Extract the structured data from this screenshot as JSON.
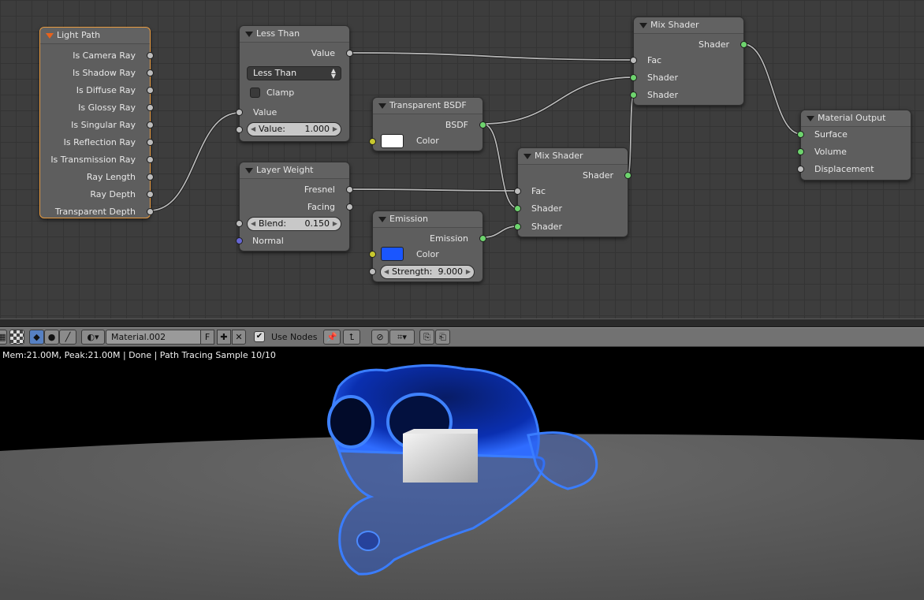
{
  "nodes": {
    "light_path": {
      "title": "Light Path",
      "outputs": [
        "Is Camera Ray",
        "Is Shadow Ray",
        "Is Diffuse Ray",
        "Is Glossy Ray",
        "Is Singular Ray",
        "Is Reflection Ray",
        "Is Transmission Ray",
        "Ray Length",
        "Ray Depth",
        "Transparent Depth"
      ]
    },
    "less_than": {
      "title": "Less Than",
      "output": "Value",
      "operation": "Less Than",
      "clamp_label": "Clamp",
      "input_label": "Value",
      "value_field_label": "Value:",
      "value_field_value": "1.000"
    },
    "layer_weight": {
      "title": "Layer Weight",
      "output_fresnel": "Fresnel",
      "output_facing": "Facing",
      "blend_label": "Blend:",
      "blend_value": "0.150",
      "normal_label": "Normal"
    },
    "transparent_bsdf": {
      "title": "Transparent BSDF",
      "output": "BSDF",
      "color_label": "Color",
      "color": "#ffffff"
    },
    "emission": {
      "title": "Emission",
      "output": "Emission",
      "color_label": "Color",
      "color": "#1a56ff",
      "strength_label": "Strength:",
      "strength_value": "9.000"
    },
    "mix_shader_top": {
      "title": "Mix Shader",
      "output": "Shader",
      "fac_label": "Fac",
      "shader1_label": "Shader",
      "shader2_label": "Shader"
    },
    "mix_shader_mid": {
      "title": "Mix Shader",
      "output": "Shader",
      "fac_label": "Fac",
      "shader1_label": "Shader",
      "shader2_label": "Shader"
    },
    "material_output": {
      "title": "Material Output",
      "surface_label": "Surface",
      "volume_label": "Volume",
      "displacement_label": "Displacement"
    }
  },
  "toolbar": {
    "material_name": "Material.002",
    "fake_user_label": "F",
    "use_nodes_label": "Use Nodes"
  },
  "render": {
    "status": "Mem:21.00M, Peak:21.00M | Done | Path Tracing Sample 10/10"
  },
  "colors": {
    "socket_shader": "#6ed46e",
    "socket_value": "#bdbdbd",
    "socket_color": "#c8c82e",
    "socket_vector": "#6666d4",
    "active_outline": "#e89b40",
    "emission_blue": "#1a56ff"
  }
}
